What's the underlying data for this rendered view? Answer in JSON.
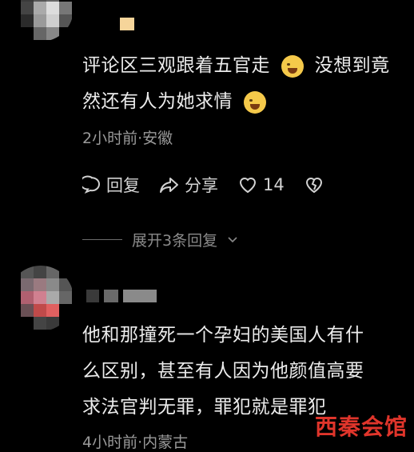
{
  "comment1": {
    "text_line1": "评论区三观跟着五官走",
    "text_line1b": "没想到竟",
    "text_line2": "然还有人为她求情",
    "meta": "2小时前·安徽",
    "reply_label": "回复",
    "share_label": "分享",
    "like_count": "14",
    "expand_label": "展开3条回复"
  },
  "comment2": {
    "line1": "他和那撞死一个孕妇的美国人有什",
    "line2": "么区别，甚至有人因为他颜值高要",
    "line3": "求法官判无罪，罪犯就是罪犯",
    "meta": "4小时前·内蒙古"
  },
  "watermark": "西秦会馆",
  "colors": {
    "background": "#000000",
    "text": "#ececec",
    "meta": "#9a9a9a",
    "watermark": "#e0352b"
  },
  "icons": [
    "comment-bubble-icon",
    "share-arrow-icon",
    "heart-icon",
    "broken-heart-icon",
    "chevron-down-icon"
  ]
}
